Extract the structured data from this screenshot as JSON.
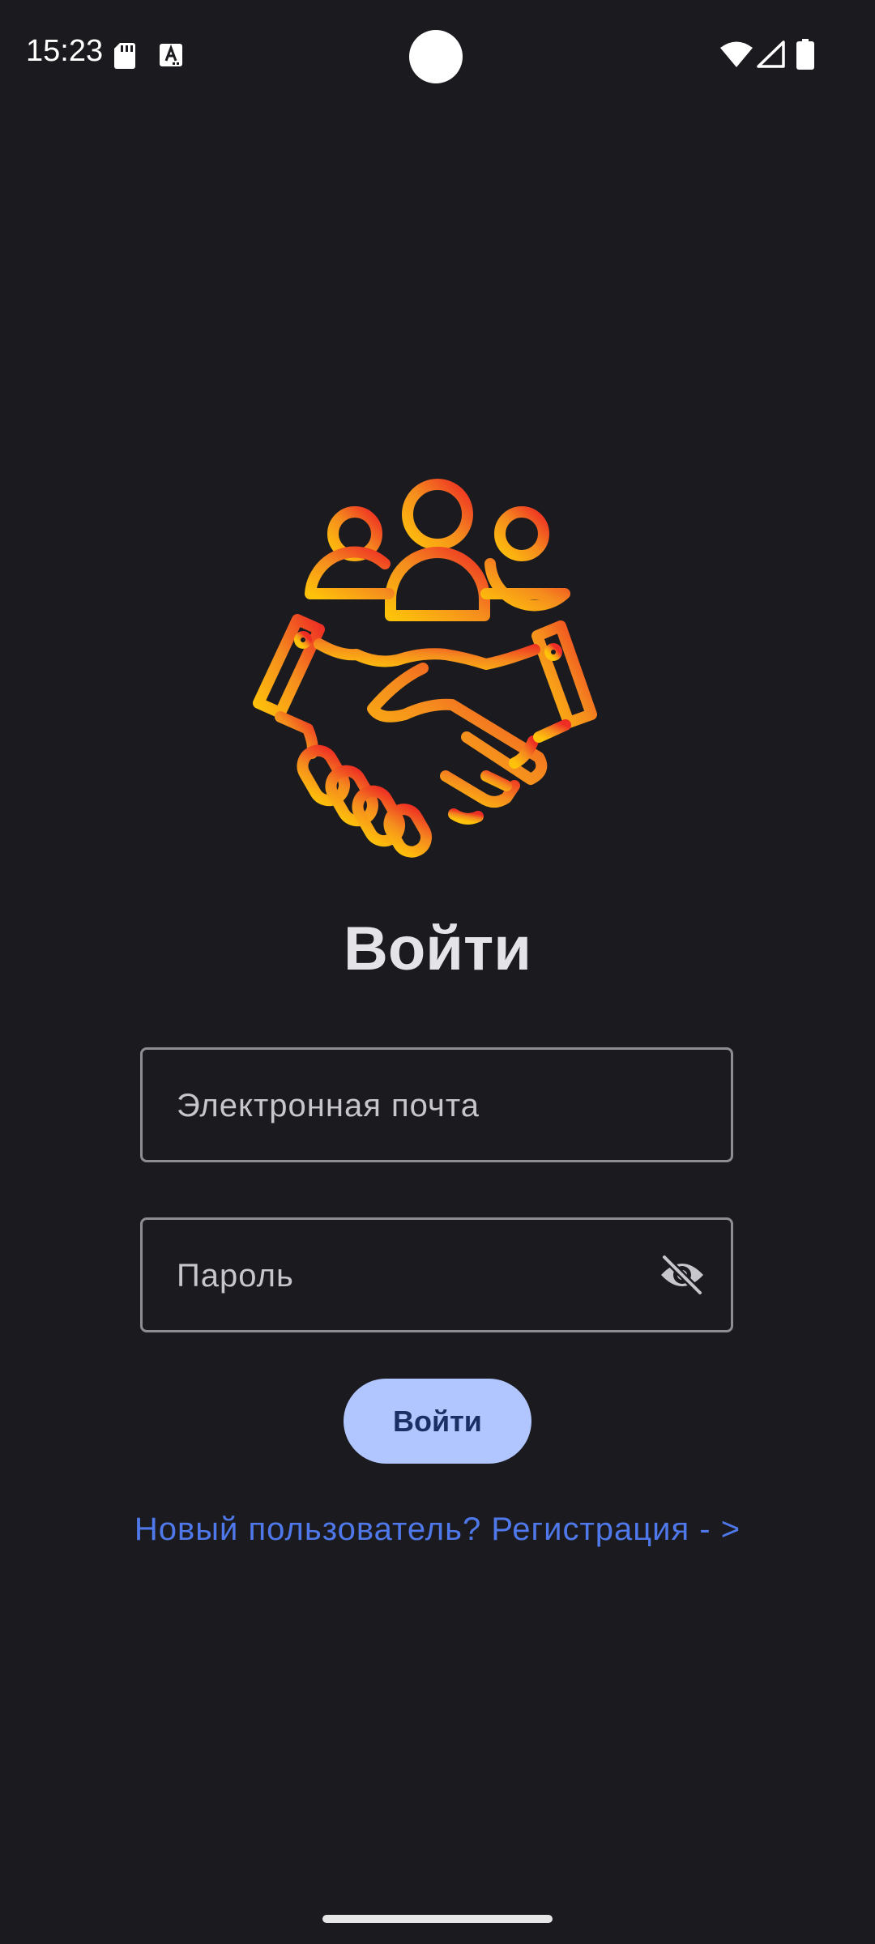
{
  "status_bar": {
    "time": "15:23",
    "icons": [
      "sd-card-icon",
      "a-text-icon",
      "wifi-icon",
      "signal-icon",
      "battery-icon"
    ]
  },
  "logo": {
    "icon": "handshake-people-icon",
    "gradient": [
      "#fec20a",
      "#f58c1e",
      "#ee2d24"
    ]
  },
  "login": {
    "title": "Войти",
    "email_placeholder": "Электронная почта",
    "email_value": "",
    "password_placeholder": "Пароль",
    "password_value": "",
    "password_toggle_icon": "eye-off-icon",
    "button_label": "Войти",
    "register_link": "Новый пользователь? Регистрация - >"
  },
  "colors": {
    "background": "#1b1b1f",
    "button_bg": "#b1c5ff",
    "button_text": "#1a2f64",
    "link": "#4f78ea",
    "outline": "#8d8d94"
  }
}
